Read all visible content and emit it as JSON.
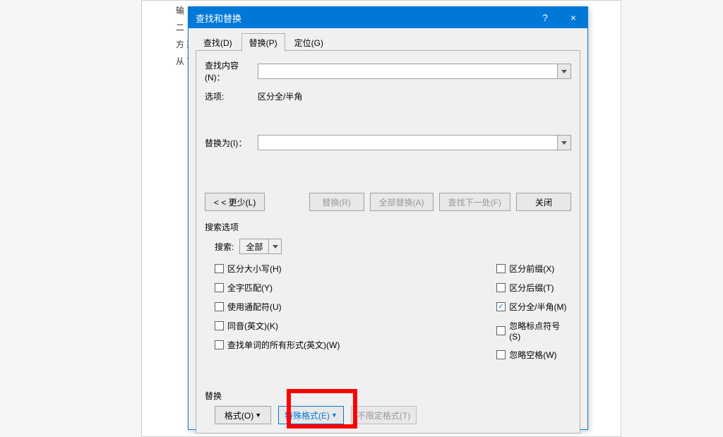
{
  "background": {
    "lines": [
      "输",
      "二",
      "方                                                                                                                                                    菜单，",
      "从                                                                                                                                                     可。"
    ]
  },
  "dialog": {
    "title": "查找和替换",
    "help_tooltip": "?",
    "close_tooltip": "×",
    "tabs": {
      "find": "查找(D)",
      "replace": "替换(P)",
      "goto": "定位(G)"
    },
    "find_label": "查找内容(N)：",
    "find_value": "",
    "options_label": "选项:",
    "options_value": "区分全/半角",
    "replace_label": "替换为(I)：",
    "replace_value": "",
    "buttons": {
      "less": "< < 更少(L)",
      "replace": "替换(R)",
      "replace_all": "全部替换(A)",
      "find_next": "查找下一处(F)",
      "close": "关闭"
    },
    "search_options": {
      "group_label": "搜索选项",
      "search_label": "搜索:",
      "search_value": "全部",
      "left": {
        "match_case": "区分大小写(H)",
        "whole_word": "全字匹配(Y)",
        "wildcards": "使用通配符(U)",
        "sounds_like": "同音(英文)(K)",
        "word_forms": "查找单词的所有形式(英文)(W)"
      },
      "right": {
        "match_prefix": "区分前缀(X)",
        "match_suffix": "区分后缀(T)",
        "full_half": "区分全/半角(M)",
        "ignore_punct": "忽略标点符号(S)",
        "ignore_space": "忽略空格(W)"
      }
    },
    "bottom": {
      "group_label": "替换",
      "format": "格式(O)",
      "special": "特殊格式(E)",
      "no_format": "不限定格式(T)"
    }
  }
}
